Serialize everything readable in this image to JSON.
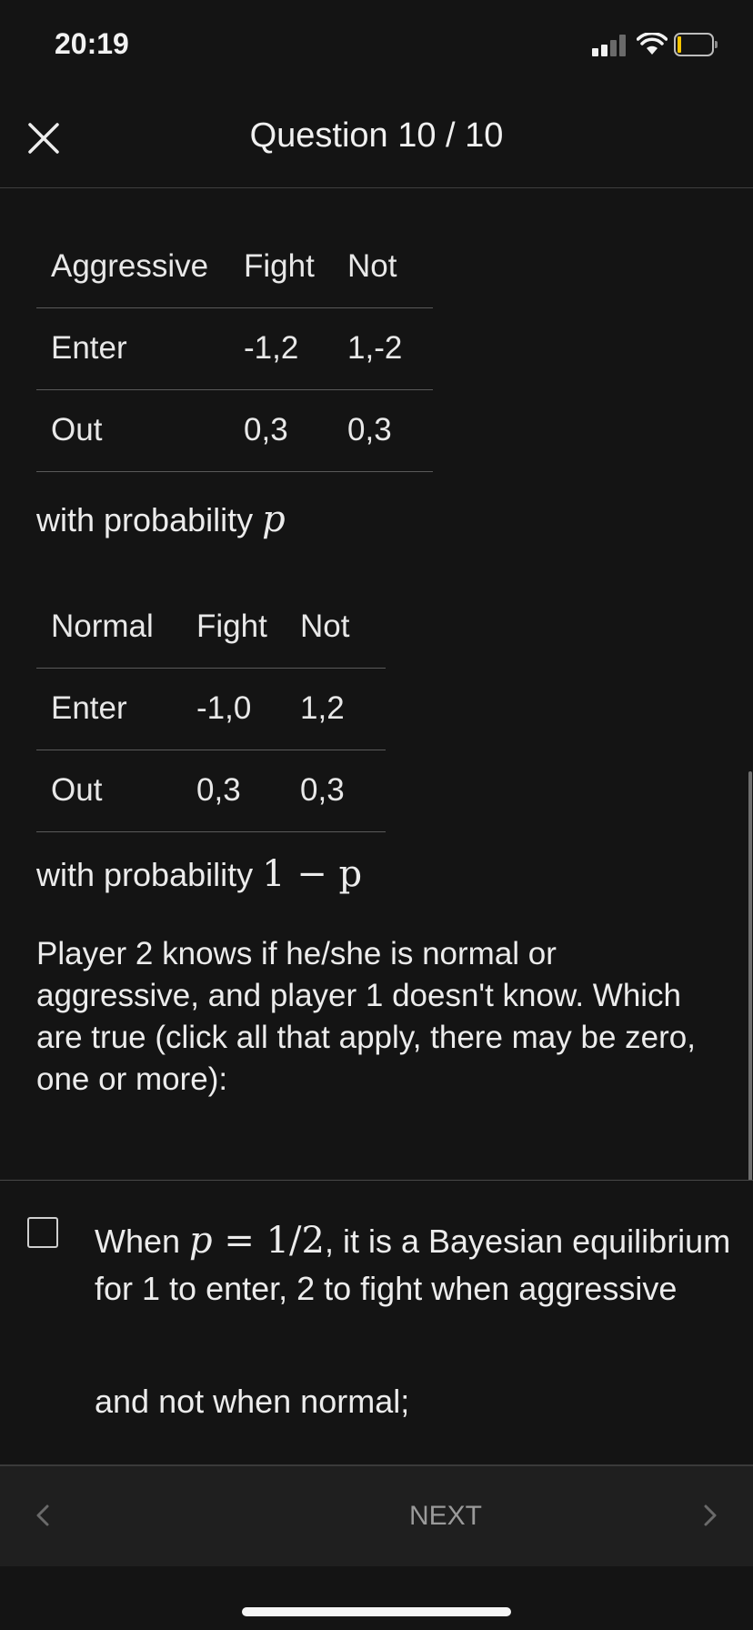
{
  "status_bar": {
    "time": "20:19"
  },
  "header": {
    "title": "Question 10 / 10",
    "close_icon": "close-icon"
  },
  "tables": {
    "aggressive": {
      "headers": [
        "Aggressive",
        "Fight",
        "Not"
      ],
      "rows": [
        [
          "Enter",
          "-1,2",
          "1,-2"
        ],
        [
          "Out",
          "0,3",
          "0,3"
        ]
      ]
    },
    "normal": {
      "headers": [
        "Normal",
        "Fight",
        "Not"
      ],
      "rows": [
        [
          "Enter",
          "-1,0",
          "1,2"
        ],
        [
          "Out",
          "0,3",
          "0,3"
        ]
      ]
    }
  },
  "probability_lines": {
    "p": {
      "text": "with probability ",
      "math": "p"
    },
    "one_minus_p": {
      "text": "with probability ",
      "math": "1 − p"
    }
  },
  "question": {
    "text": "Player 2 knows if he/she is normal or aggressive, and player 1 doesn't know. Which are true (click all that apply, there may be zero, one or more):"
  },
  "option": {
    "checked": false,
    "prefix": "When ",
    "math_p": "p",
    "math_eq": " = 1/2",
    "rest": ", it is a Bayesian equilibrium for 1 to enter, 2 to fight when aggressive",
    "line2": "and not when normal;"
  },
  "bottom_nav": {
    "prev_icon": "chevron-left-icon",
    "next_label": "NEXT",
    "next_icon": "chevron-right-icon"
  },
  "colors": {
    "background": "#141414",
    "text": "#ececec",
    "divider": "#5a5a5a",
    "nav_background": "#1f1f1f",
    "battery_level": "#f5c400"
  }
}
